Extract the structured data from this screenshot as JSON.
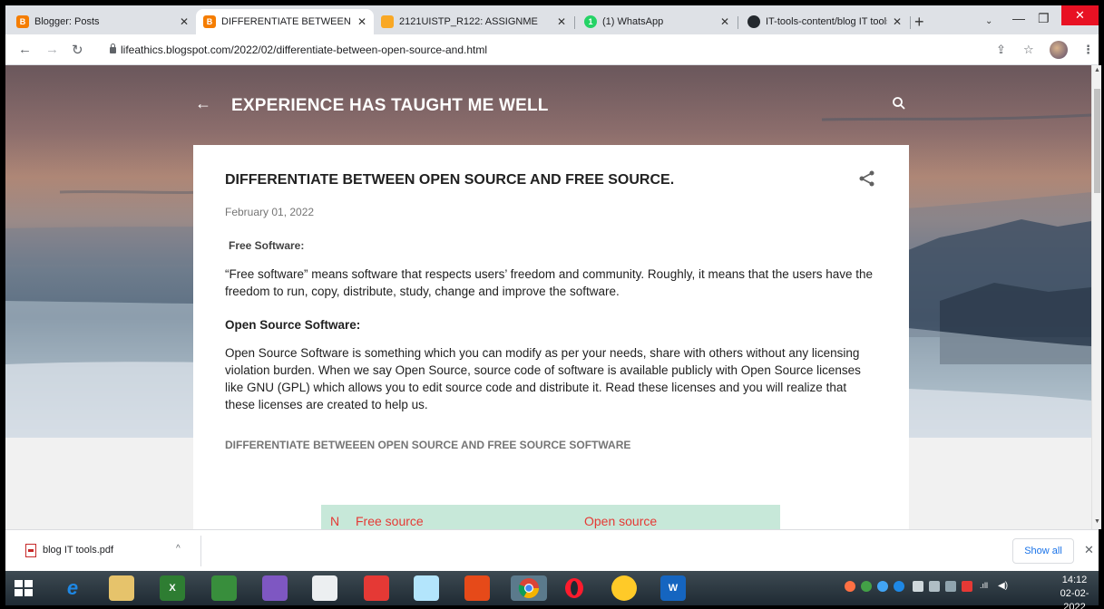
{
  "browser": {
    "tabs": [
      {
        "title": "Blogger: Posts",
        "favicon": "blogger-icon",
        "color": "#f57d00"
      },
      {
        "title": "DIFFERENTIATE BETWEEN OP",
        "favicon": "blogger-icon",
        "color": "#f57d00",
        "active": true
      },
      {
        "title": "2121UISTP_R122: ASSIGNME",
        "favicon": "classroom-icon",
        "color": "#f9a825"
      },
      {
        "title": "(1) WhatsApp",
        "favicon": "whatsapp-icon",
        "color": "#25d366"
      },
      {
        "title": "IT-tools-content/blog IT tools",
        "favicon": "github-icon",
        "color": "#24292e"
      }
    ],
    "new_tab": "+",
    "address": "lifeathics.blogspot.com/2022/02/differentiate-between-open-source-and.html"
  },
  "blog": {
    "title": "EXPERIENCE HAS TAUGHT ME WELL",
    "post": {
      "title": "DIFFERENTIATE BETWEEN OPEN SOURCE AND FREE SOURCE.",
      "date": "February 01, 2022",
      "free_heading": "Free Software:",
      "free_text": "“Free software” means software that respects users’ freedom and community. Roughly, it means that the users have the freedom to run, copy, distribute, study, change and improve the software.",
      "open_heading": "Open Source Software:",
      "open_text": "Open Source Software is something which you can modify as per your needs, share with others without any licensing violation burden. When we say Open Source, source code of software is available publicly with Open Source licenses like GNU (GPL) which allows you to edit source code and distribute it. Read these licenses and you will realize that these licenses are created to help us.",
      "diff_heading": "DIFFERENTIATE BETWEEEN OPEN SOURCE AND FREE SOURCE SOFTWARE",
      "table_header": [
        "N",
        "Free source",
        "Open source"
      ]
    }
  },
  "downloads": {
    "file": "blog IT tools.pdf",
    "show_all": "Show all"
  },
  "taskbar": {
    "time": "14:12",
    "date": "02-02-2022"
  }
}
